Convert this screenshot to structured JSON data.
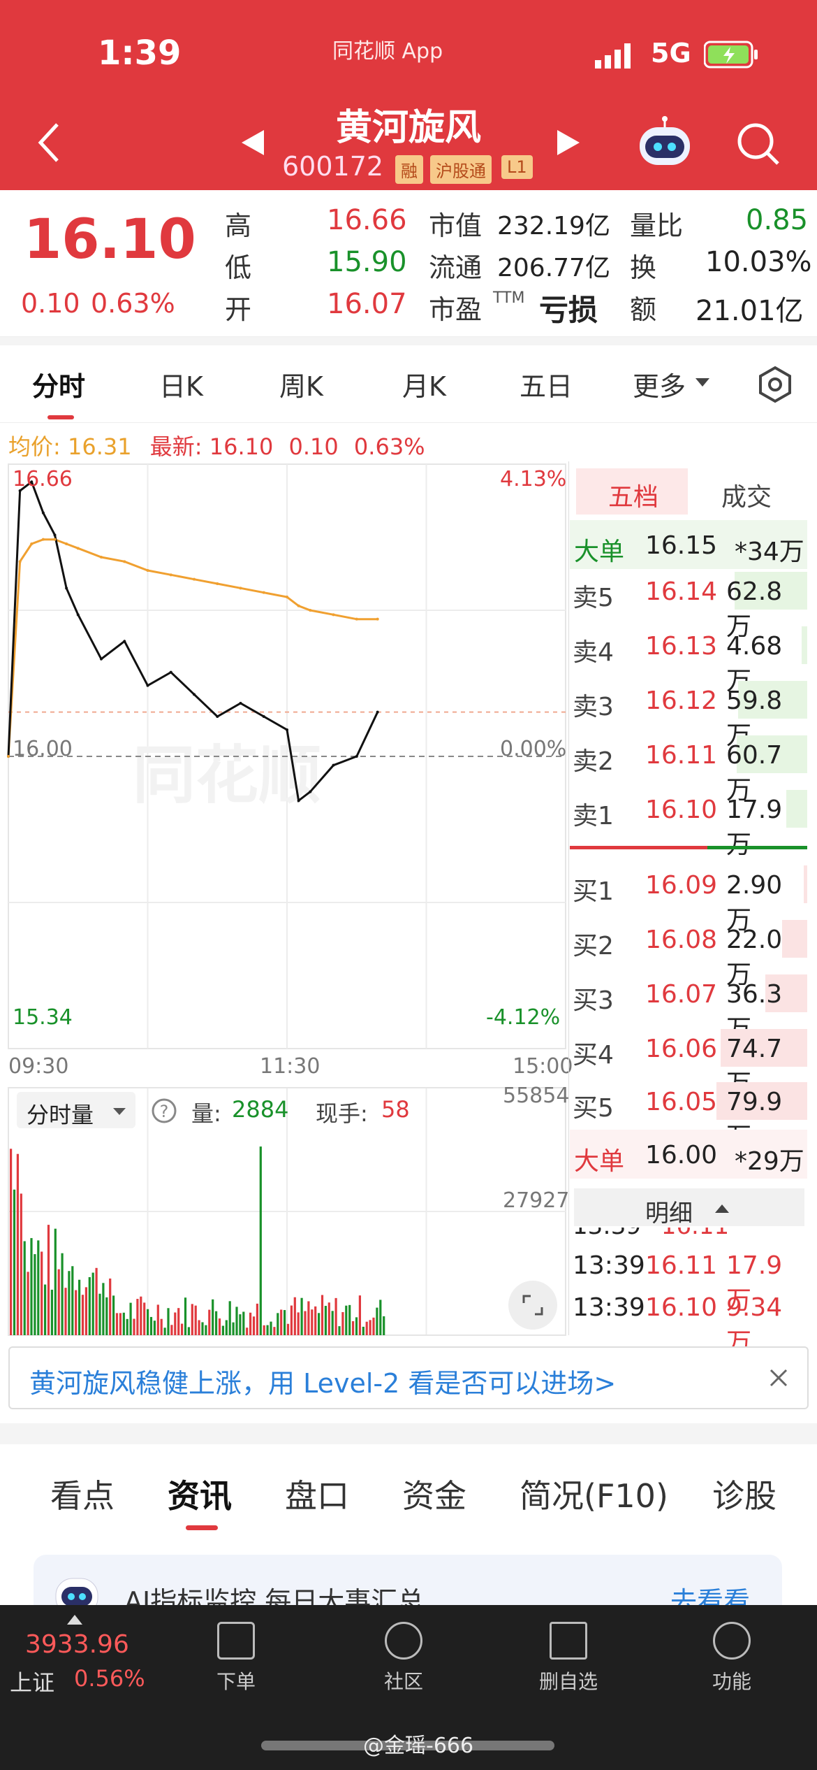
{
  "status_bar": {
    "time": "1:39",
    "app_label": "同花顺 App",
    "network": "5G"
  },
  "header": {
    "stock_name": "黄河旋风",
    "stock_code": "600172",
    "tags": [
      "融",
      "沪股通",
      "L1"
    ]
  },
  "quote": {
    "price": "16.10",
    "change": "0.10",
    "change_pct": "0.63%",
    "high_label": "高",
    "high": "16.66",
    "low_label": "低",
    "low": "15.90",
    "open_label": "开",
    "open": "16.07",
    "mktcap_label": "市值",
    "mktcap": "232.19亿",
    "float_label": "流通",
    "float": "206.77亿",
    "pe_label": "市盈",
    "pe_sup": "TTM",
    "pe": "亏损",
    "vol_ratio_label": "量比",
    "vol_ratio": "0.85",
    "turnover_label": "换",
    "turnover": "10.03%",
    "amount_label": "额",
    "amount": "21.01亿"
  },
  "chart_tabs": [
    "分时",
    "日K",
    "周K",
    "月K",
    "五日",
    "更多"
  ],
  "chart_info": {
    "avg_label": "均价:",
    "avg": "16.31",
    "last_label": "最新:",
    "last": "16.10",
    "chg": "0.10",
    "chg_pct": "0.63%"
  },
  "intraday": {
    "top_price": "16.66",
    "top_pct": "4.13%",
    "mid_price": "16.00",
    "mid_pct": "0.00%",
    "bottom_price": "15.34",
    "bottom_pct": "-4.12%",
    "times": [
      "09:30",
      "11:30",
      "15:00"
    ],
    "vol_selector": "分时量",
    "vol_label": "量:",
    "vol": "2884",
    "hand_label": "现手:",
    "hand": "58",
    "vol_max": "55854",
    "vol_mid": "27927"
  },
  "chart_data": {
    "type": "line",
    "x": [
      "09:30",
      "09:35",
      "09:40",
      "09:45",
      "09:50",
      "09:55",
      "10:00",
      "10:10",
      "10:20",
      "10:30",
      "10:40",
      "10:50",
      "11:00",
      "11:10",
      "11:20",
      "11:30",
      "13:05",
      "13:10",
      "13:20",
      "13:30",
      "13:39"
    ],
    "series": [
      {
        "name": "最新",
        "values": [
          16.0,
          16.6,
          16.62,
          16.55,
          16.5,
          16.38,
          16.32,
          16.22,
          16.26,
          16.16,
          16.19,
          16.14,
          16.09,
          16.12,
          16.09,
          16.06,
          15.9,
          15.92,
          15.98,
          16.0,
          16.1
        ]
      },
      {
        "name": "均价",
        "values": [
          16.0,
          16.44,
          16.48,
          16.49,
          16.49,
          16.48,
          16.47,
          16.45,
          16.44,
          16.42,
          16.41,
          16.4,
          16.39,
          16.38,
          16.37,
          16.36,
          16.34,
          16.33,
          16.32,
          16.31,
          16.31
        ]
      }
    ],
    "ylim": [
      15.34,
      16.66
    ],
    "ylabel": ""
  },
  "order_book": {
    "tab_active": "五档",
    "tab_other": "成交",
    "big_sell": {
      "label": "大单",
      "price": "16.15",
      "qty": "*34万"
    },
    "asks": [
      {
        "label": "卖5",
        "price": "16.14",
        "qty": "62.8万",
        "bar": 0.8
      },
      {
        "label": "卖4",
        "price": "16.13",
        "qty": "4.68万",
        "bar": 0.06
      },
      {
        "label": "卖3",
        "price": "16.12",
        "qty": "59.8万",
        "bar": 0.76
      },
      {
        "label": "卖2",
        "price": "16.11",
        "qty": "60.7万",
        "bar": 0.78
      },
      {
        "label": "卖1",
        "price": "16.10",
        "qty": "17.9万",
        "bar": 0.23
      }
    ],
    "bids": [
      {
        "label": "买1",
        "price": "16.09",
        "qty": "2.90万",
        "bar": 0.04
      },
      {
        "label": "买2",
        "price": "16.08",
        "qty": "22.0万",
        "bar": 0.28
      },
      {
        "label": "买3",
        "price": "16.07",
        "qty": "36.3万",
        "bar": 0.46
      },
      {
        "label": "买4",
        "price": "16.06",
        "qty": "74.7万",
        "bar": 0.95
      },
      {
        "label": "买5",
        "price": "16.05",
        "qty": "79.9万",
        "bar": 1.0
      }
    ],
    "big_buy": {
      "label": "大单",
      "price": "16.00",
      "qty": "*29万"
    },
    "detail_label": "明细",
    "trades": [
      {
        "time": "13:39",
        "price": "16.11",
        "qty": "17.9万"
      },
      {
        "time": "13:39",
        "price": "16.10",
        "qty": "9.34万"
      }
    ]
  },
  "banner": {
    "text": "黄河旋风稳健上涨，用 Level-2 看是否可以进场>"
  },
  "bottom_tabs": [
    "看点",
    "资讯",
    "盘口",
    "资金",
    "简况(F10)",
    "诊股"
  ],
  "ai_card": {
    "text": "AI指标监控 每日大事汇总",
    "link": "去看看"
  },
  "bottom_nav": {
    "index_value": "3933.96",
    "index_name": "上证",
    "index_pct": "0.56%",
    "items": [
      "下单",
      "社区",
      "删自选",
      "功能"
    ]
  },
  "watermark": "@金瑶-666",
  "colors": {
    "brand_red": "#e0393e",
    "up_green": "#19912a",
    "avg_line": "#f0a030"
  }
}
